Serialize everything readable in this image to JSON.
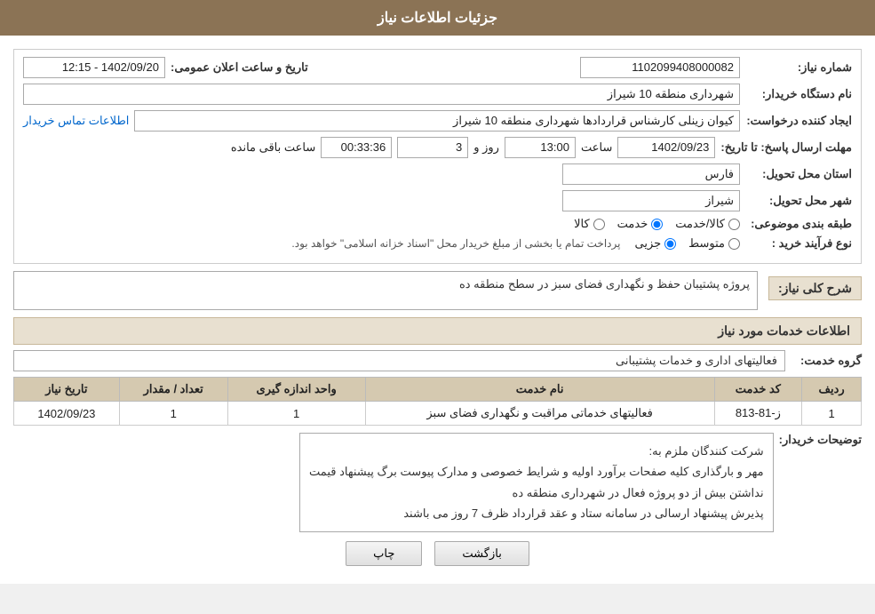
{
  "header": {
    "title": "جزئیات اطلاعات نیاز"
  },
  "fields": {
    "need_number_label": "شماره نیاز:",
    "need_number_value": "1102099408000082",
    "buyer_org_label": "نام دستگاه خریدار:",
    "buyer_org_value": "شهرداری منطقه 10 شیراز",
    "creator_label": "ایجاد کننده درخواست:",
    "creator_value": "کیوان زینلی کارشناس قراردادها شهرداری منطقه 10 شیراز",
    "creator_link": "اطلاعات تماس خریدار",
    "send_date_label": "مهلت ارسال پاسخ: تا تاریخ:",
    "send_date_value": "1402/09/23",
    "send_time_label": "ساعت",
    "send_time_value": "13:00",
    "send_day_label": "روز و",
    "send_day_value": "3",
    "remaining_label": "ساعت باقی مانده",
    "remaining_value": "00:33:36",
    "announce_date_label": "تاریخ و ساعت اعلان عمومی:",
    "announce_date_value": "1402/09/20 - 12:15",
    "province_label": "استان محل تحویل:",
    "province_value": "فارس",
    "city_label": "شهر محل تحویل:",
    "city_value": "شیراز",
    "category_label": "طبقه بندی موضوعی:",
    "category_options": [
      {
        "label": "کالا",
        "value": "kala"
      },
      {
        "label": "خدمت",
        "value": "khedmat"
      },
      {
        "label": "کالا/خدمت",
        "value": "kala_khedmat"
      }
    ],
    "category_selected": "khedmat",
    "purchase_type_label": "نوع فرآیند خرید :",
    "purchase_type_options": [
      {
        "label": "جزیی",
        "value": "jozei"
      },
      {
        "label": "متوسط",
        "value": "motevaset"
      }
    ],
    "purchase_type_selected": "jozei",
    "purchase_note": "پرداخت تمام یا بخشی از مبلغ خریدار محل \"اسناد خزانه اسلامی\" خواهد بود."
  },
  "need_description": {
    "section_title": "شرح کلی نیاز:",
    "value": "پروژه پشتیبان حفظ و نگهداری فضای سبز در سطح منطقه ده"
  },
  "service_info": {
    "section_title": "اطلاعات خدمات مورد نیاز",
    "group_label": "گروه خدمت:",
    "group_value": "فعالیتهای اداری و خدمات پشتیبانی",
    "table": {
      "headers": [
        "ردیف",
        "کد خدمت",
        "نام خدمت",
        "واحد اندازه گیری",
        "تعداد / مقدار",
        "تاریخ نیاز"
      ],
      "rows": [
        {
          "row_num": "1",
          "service_code": "ز-81-813",
          "service_name": "فعالیتهای خدماتی مراقبت و نگهداری فضای سبز",
          "unit": "1",
          "quantity": "1",
          "date": "1402/09/23"
        }
      ]
    }
  },
  "buyer_notes": {
    "label": "توضیحات خریدار:",
    "lines": [
      "شرکت کنندگان ملزم به:",
      "مهر و بارگذاری کلیه صفحات برآورد اولیه و شرایط خصوصی و مدارک پیوست برگ پیشنهاد قیمت",
      "نداشتن بیش از دو پروژه فعال در شهرداری منطقه ده",
      "پذیرش پیشنهاد ارسالی در سامانه ستاد و عقد قرارداد ظرف 7 روز می باشند"
    ]
  },
  "buttons": {
    "print_label": "چاپ",
    "back_label": "بازگشت"
  }
}
